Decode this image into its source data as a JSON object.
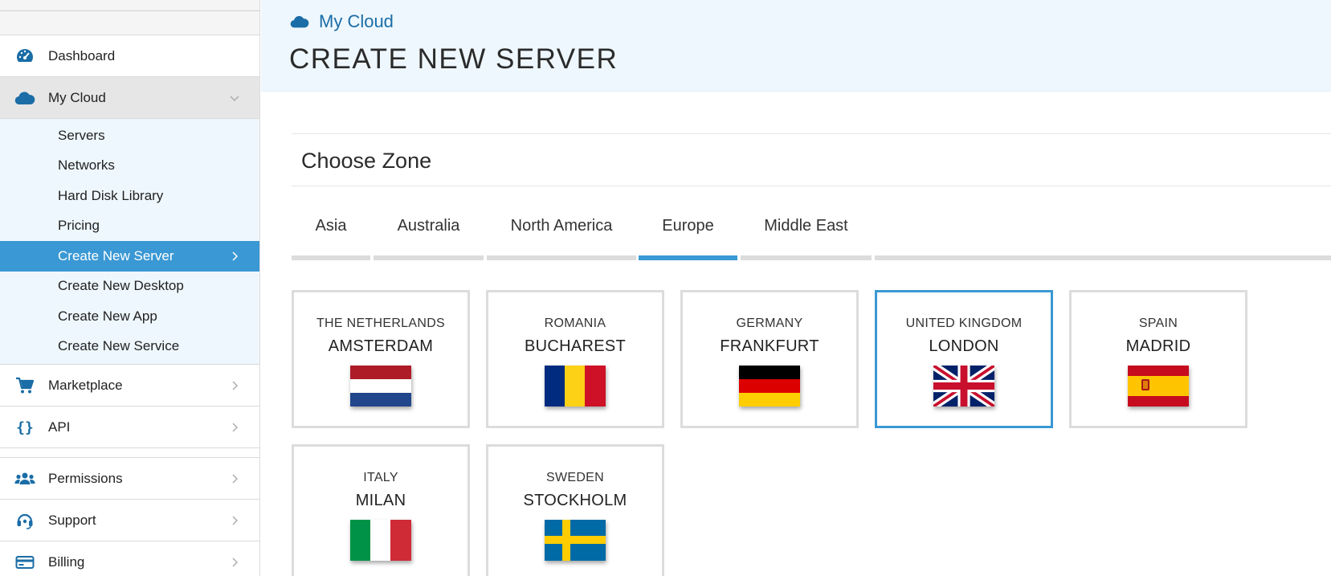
{
  "sidebar": {
    "items": [
      {
        "label": "Dashboard",
        "icon": "gauge-icon"
      },
      {
        "label": "My Cloud",
        "icon": "cloud-icon"
      }
    ],
    "subitems": [
      "Servers",
      "Networks",
      "Hard Disk Library",
      "Pricing",
      "Create New Server",
      "Create New Desktop",
      "Create New App",
      "Create New Service"
    ],
    "active_subitem": "Create New Server",
    "lower_items": [
      {
        "label": "Marketplace",
        "icon": "cart-icon"
      },
      {
        "label": "API",
        "icon": "braces-icon"
      }
    ],
    "bottom_items": [
      {
        "label": "Permissions",
        "icon": "users-icon"
      },
      {
        "label": "Support",
        "icon": "headset-icon"
      },
      {
        "label": "Billing",
        "icon": "credit-card-icon"
      }
    ]
  },
  "header": {
    "breadcrumb": "My Cloud",
    "title": "CREATE NEW SERVER"
  },
  "zone": {
    "title": "Choose Zone",
    "tabs": [
      "Asia",
      "Australia",
      "North America",
      "Europe",
      "Middle East"
    ],
    "active_tab": "Europe",
    "locations": [
      {
        "country": "THE NETHERLANDS",
        "city": "AMSTERDAM",
        "flag": "netherlands-flag-icon"
      },
      {
        "country": "ROMANIA",
        "city": "BUCHAREST",
        "flag": "romania-flag-icon"
      },
      {
        "country": "GERMANY",
        "city": "FRANKFURT",
        "flag": "germany-flag-icon"
      },
      {
        "country": "UNITED KINGDOM",
        "city": "LONDON",
        "flag": "uk-flag-icon",
        "selected": true
      },
      {
        "country": "SPAIN",
        "city": "MADRID",
        "flag": "spain-flag-icon"
      },
      {
        "country": "ITALY",
        "city": "MILAN",
        "flag": "italy-flag-icon"
      },
      {
        "country": "SWEDEN",
        "city": "STOCKHOLM",
        "flag": "sweden-flag-icon"
      }
    ]
  },
  "colors": {
    "accent": "#3a98d4",
    "icon_blue": "#1a6da6",
    "header_bg": "#eef7fd"
  }
}
